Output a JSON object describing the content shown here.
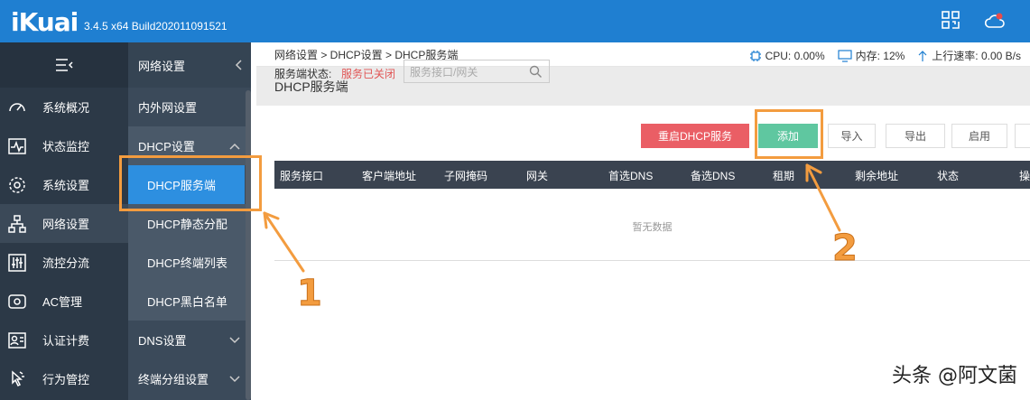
{
  "header": {
    "logo": "iKuai",
    "version": "3.4.5 x64 Build202011091521"
  },
  "leftnav": {
    "items": [
      {
        "label": "系统概况",
        "icon": "dashboard-icon"
      },
      {
        "label": "状态监控",
        "icon": "pulse-icon"
      },
      {
        "label": "系统设置",
        "icon": "gear-icon"
      },
      {
        "label": "网络设置",
        "icon": "network-icon"
      },
      {
        "label": "流控分流",
        "icon": "sliders-icon"
      },
      {
        "label": "AC管理",
        "icon": "router-icon"
      },
      {
        "label": "认证计费",
        "icon": "id-card-icon"
      },
      {
        "label": "行为管控",
        "icon": "pointer-icon"
      }
    ]
  },
  "subnav": {
    "header": "网络设置",
    "items": {
      "wan_lan": "内外网设置",
      "dhcp_group": "DHCP设置",
      "dhcp_server": "DHCP服务端",
      "dhcp_static": "DHCP静态分配",
      "dhcp_clients": "DHCP终端列表",
      "dhcp_blacklist": "DHCP黑白名单",
      "dns": "DNS设置",
      "terminal_group": "终端分组设置"
    }
  },
  "main": {
    "breadcrumb": "网络设置 > DHCP设置 > DHCP服务端",
    "stats": {
      "cpu": "CPU: 0.00%",
      "mem": "内存: 12%",
      "upload": "上行速率: 0.00 B/s"
    },
    "title": "DHCP服务端",
    "status_label": "服务端状态:",
    "status_value": "服务已关闭",
    "search_placeholder": "服务接口/网关",
    "buttons": {
      "restart": "重启DHCP服务",
      "add": "添加",
      "import": "导入",
      "export": "导出",
      "enable": "启用"
    },
    "columns": [
      "服务接口",
      "客户端地址",
      "子网掩码",
      "网关",
      "首选DNS",
      "备选DNS",
      "租期",
      "剩余地址",
      "状态",
      "操"
    ],
    "empty_text": "暂无数据"
  },
  "annotations": {
    "one": "1",
    "two": "2",
    "color": "#f39c3f"
  },
  "watermark": "头条 @阿文菌"
}
